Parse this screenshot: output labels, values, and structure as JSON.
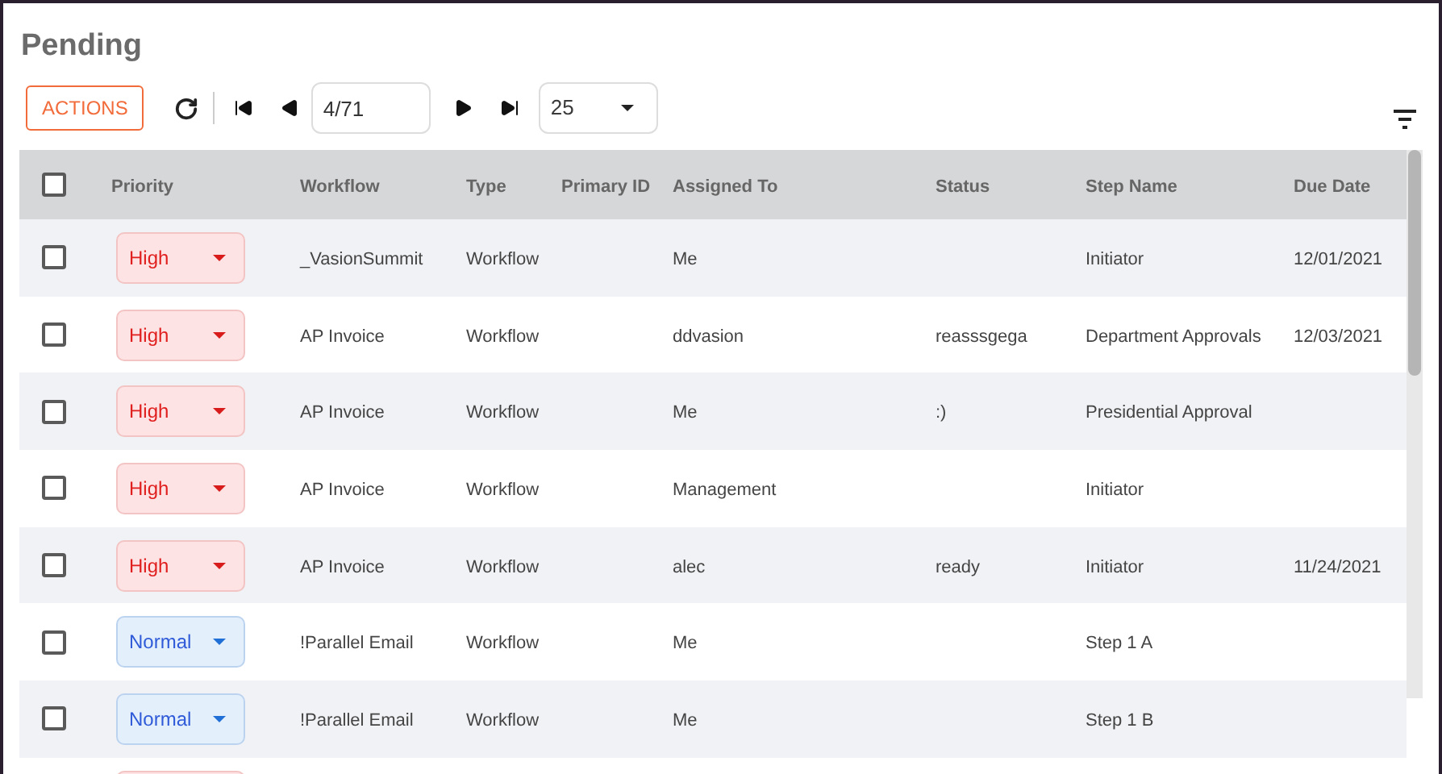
{
  "title": "Pending",
  "toolbar": {
    "actions_button": "ACTIONS",
    "page_field": "4/71",
    "page_size": "25"
  },
  "table": {
    "columns": [
      "Priority",
      "Workflow",
      "Type",
      "Primary ID",
      "Assigned To",
      "Status",
      "Step Name",
      "Due Date"
    ],
    "header_checked": false,
    "rows": [
      {
        "checked": false,
        "priority": {
          "kind": "high",
          "label": "High"
        },
        "workflow": "_VasionSummit",
        "type": "Workflow",
        "primary_id": "",
        "assigned_to": "Me",
        "status": "",
        "step_name": "Initiator",
        "due_date": "12/01/2021"
      },
      {
        "checked": false,
        "priority": {
          "kind": "high",
          "label": "High"
        },
        "workflow": "AP Invoice",
        "type": "Workflow",
        "primary_id": "",
        "assigned_to": "ddvasion",
        "status": "reasssgega",
        "step_name": "Department Approvals",
        "due_date": "12/03/2021"
      },
      {
        "checked": false,
        "priority": {
          "kind": "high",
          "label": "High"
        },
        "workflow": "AP Invoice",
        "type": "Workflow",
        "primary_id": "",
        "assigned_to": "Me",
        "status": ":)",
        "step_name": "Presidential Approval",
        "due_date": ""
      },
      {
        "checked": false,
        "priority": {
          "kind": "high",
          "label": "High"
        },
        "workflow": "AP Invoice",
        "type": "Workflow",
        "primary_id": "",
        "assigned_to": "Management",
        "status": "",
        "step_name": "Initiator",
        "due_date": ""
      },
      {
        "checked": false,
        "priority": {
          "kind": "high",
          "label": "High"
        },
        "workflow": "AP Invoice",
        "type": "Workflow",
        "primary_id": "",
        "assigned_to": "alec",
        "status": "ready",
        "step_name": "Initiator",
        "due_date": "11/24/2021"
      },
      {
        "checked": false,
        "priority": {
          "kind": "normal",
          "label": "Normal"
        },
        "workflow": "!Parallel Email",
        "type": "Workflow",
        "primary_id": "",
        "assigned_to": "Me",
        "status": "",
        "step_name": "Step 1 A",
        "due_date": ""
      },
      {
        "checked": false,
        "priority": {
          "kind": "normal",
          "label": "Normal"
        },
        "workflow": "!Parallel Email",
        "type": "Workflow",
        "primary_id": "",
        "assigned_to": "Me",
        "status": "",
        "step_name": "Step 1 B",
        "due_date": ""
      }
    ],
    "partial_row": {
      "priority": {
        "kind": "high"
      }
    }
  }
}
